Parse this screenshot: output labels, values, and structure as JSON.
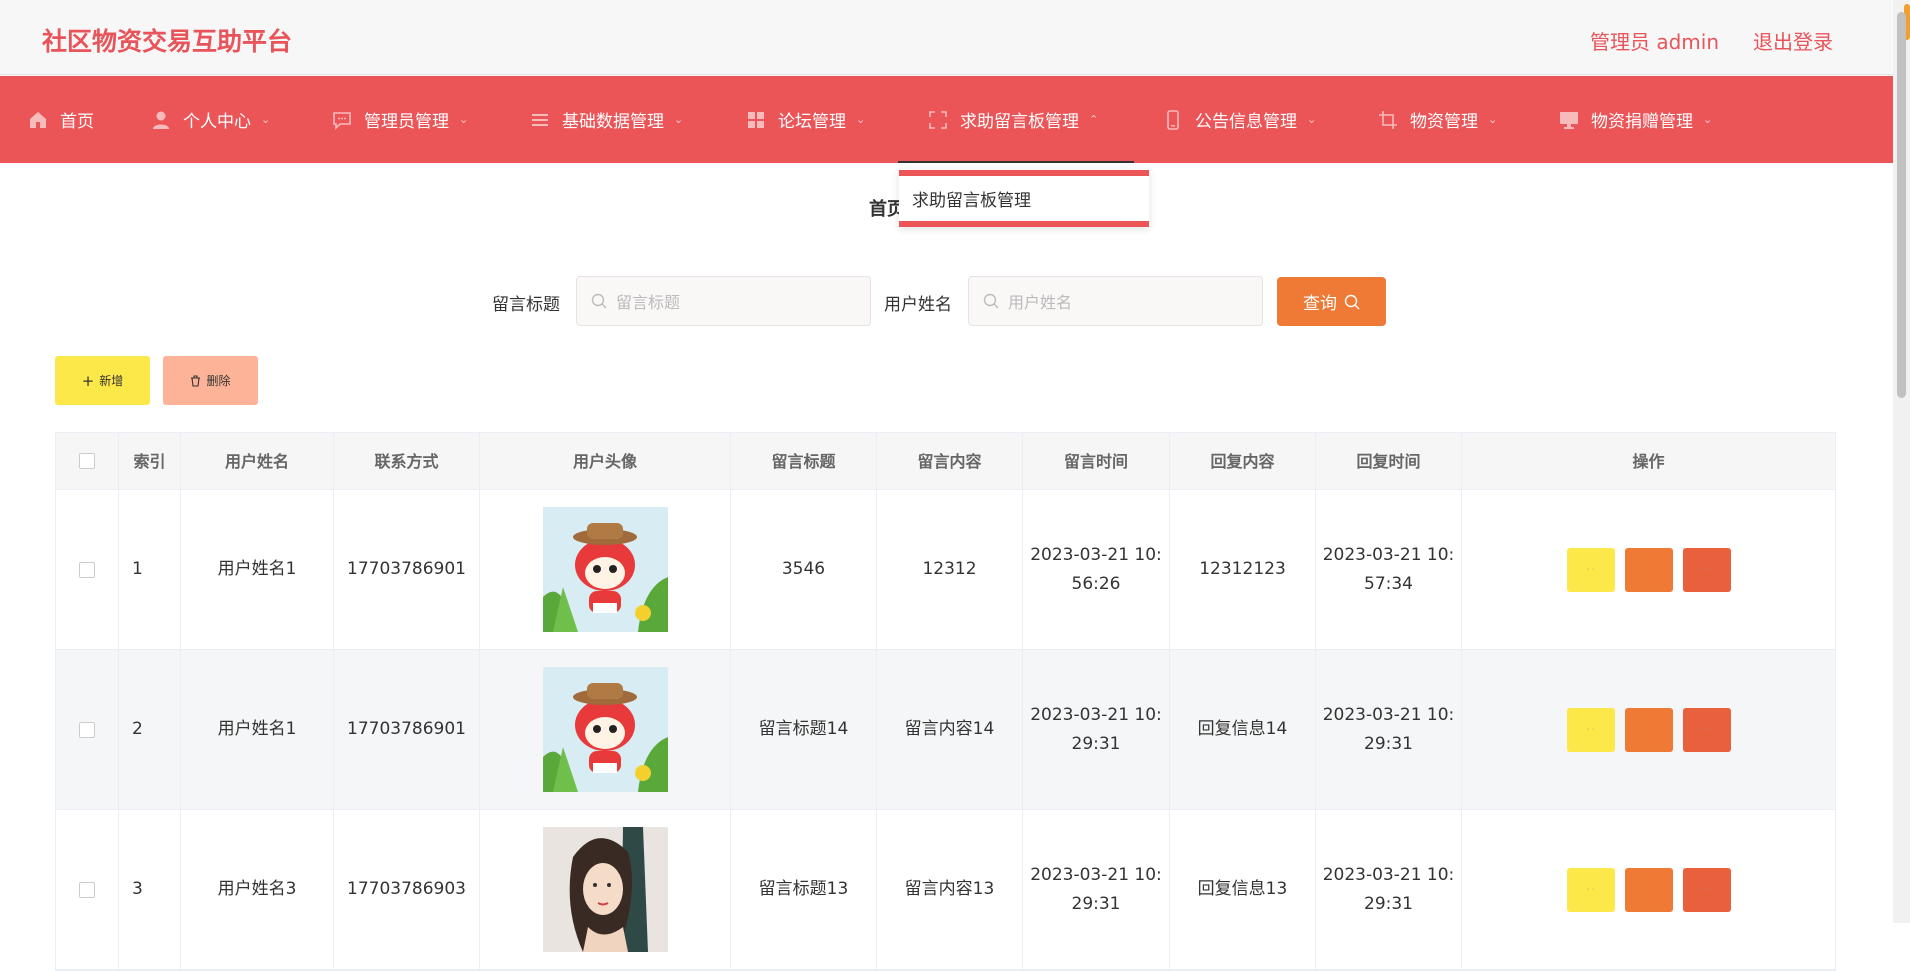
{
  "header": {
    "brand": "社区物资交易互助平台",
    "admin_label": "管理员 admin",
    "logout_label": "退出登录"
  },
  "nav": {
    "items": [
      {
        "label": "首页",
        "icon": "home-icon"
      },
      {
        "label": "个人中心",
        "icon": "user-icon"
      },
      {
        "label": "管理员管理",
        "icon": "chat-icon"
      },
      {
        "label": "基础数据管理",
        "icon": "list-icon"
      },
      {
        "label": "论坛管理",
        "icon": "grid-icon"
      },
      {
        "label": "求助留言板管理",
        "icon": "fullscreen-icon"
      },
      {
        "label": "公告信息管理",
        "icon": "mobile-icon"
      },
      {
        "label": "物资管理",
        "icon": "crop-icon"
      },
      {
        "label": "物资捐赠管理",
        "icon": "monitor-icon"
      }
    ],
    "dropdown_item": "求助留言板管理"
  },
  "breadcrumb": "首页",
  "search": {
    "title_label": "留言标题",
    "title_placeholder": "留言标题",
    "name_label": "用户姓名",
    "name_placeholder": "用户姓名",
    "query_label": "查询"
  },
  "toolbar": {
    "add_label": "新增",
    "delete_label": "删除"
  },
  "table": {
    "columns": [
      "索引",
      "用户姓名",
      "联系方式",
      "用户头像",
      "留言标题",
      "留言内容",
      "留言时间",
      "回复内容",
      "回复时间",
      "操作"
    ],
    "rows": [
      {
        "index": "1",
        "name": "用户姓名1",
        "phone": "17703786901",
        "avatar": "cartoon-fox-avatar",
        "title": "3546",
        "content": "12312",
        "time_date": "2023-03-21 10:",
        "time_clock": "56:26",
        "reply": "12312123",
        "reply_date": "2023-03-21 10:",
        "reply_clock": "57:34"
      },
      {
        "index": "2",
        "name": "用户姓名1",
        "phone": "17703786901",
        "avatar": "cartoon-fox-avatar",
        "title": "留言标题14",
        "content": "留言内容14",
        "time_date": "2023-03-21 10:",
        "time_clock": "29:31",
        "reply": "回复信息14",
        "reply_date": "2023-03-21 10:",
        "reply_clock": "29:31"
      },
      {
        "index": "3",
        "name": "用户姓名3",
        "phone": "17703786903",
        "avatar": "woman-portrait-avatar",
        "title": "留言标题13",
        "content": "留言内容13",
        "time_date": "2023-03-21 10:",
        "time_clock": "29:31",
        "reply": "回复信息13",
        "reply_date": "2023-03-21 10:",
        "reply_clock": "29:31"
      }
    ]
  },
  "colors": {
    "brand": "#e8545a",
    "nav_bg": "#eb5558",
    "query_btn": "#ef7a35",
    "add_btn": "#fde84a",
    "delete_btn": "#fdb397",
    "op_edit": "#fde84a",
    "op_detail": "#ef7a35",
    "op_delete": "#e8603c"
  }
}
